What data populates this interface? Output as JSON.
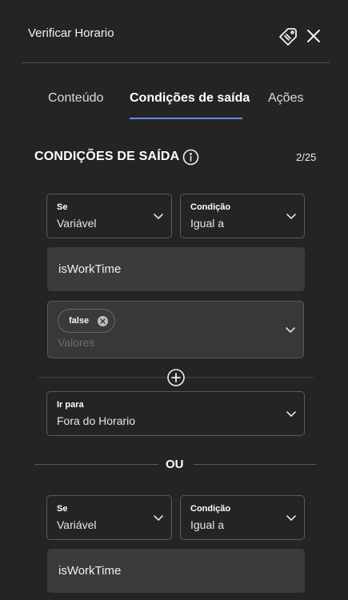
{
  "header": {
    "title": "Verificar Horario"
  },
  "tabs": [
    {
      "label": "Conteúdo",
      "active": false
    },
    {
      "label": "Condições de saída",
      "active": true
    },
    {
      "label": "Ações",
      "active": false
    }
  ],
  "section": {
    "title": "CONDIÇÕES DE SAÍDA",
    "counter": "2/25"
  },
  "condition_1": {
    "se": {
      "label": "Se",
      "value": "Variável"
    },
    "condicao": {
      "label": "Condição",
      "value": "Igual a"
    },
    "variable": "isWorkTime",
    "values": {
      "chips": [
        "false"
      ],
      "placeholder": "Valores"
    },
    "ir_para": {
      "label": "Ir para",
      "value": "Fora do Horario"
    }
  },
  "separator": "OU",
  "condition_2": {
    "se": {
      "label": "Se",
      "value": "Variável"
    },
    "condicao": {
      "label": "Condição",
      "value": "Igual a"
    },
    "variable": "isWorkTime"
  },
  "colors": {
    "background": "#242424",
    "accent": "#5b8ff2",
    "field": "#3b3b3b"
  }
}
